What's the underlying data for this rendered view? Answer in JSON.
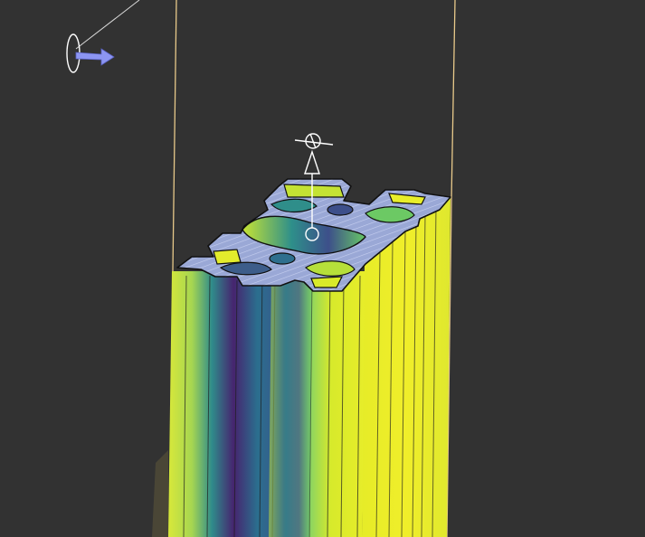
{
  "viewport": {
    "background": "#323232",
    "selection_outline_color": "#e8c98a",
    "gizmo_color": "#ffffff",
    "arrow_color": "#8c95f2"
  },
  "model": {
    "profile_fill": "#9aa8d6",
    "profile_hatch": "#c6cff0",
    "colormap": [
      "#440154",
      "#3b528b",
      "#21918c",
      "#5ec962",
      "#d9ea2a",
      "#fde725"
    ],
    "icons": {
      "light": "light-source-icon",
      "direction": "direction-arrow-icon",
      "rotation": "rotation-gizmo-icon",
      "translation": "translate-gizmo-icon",
      "pivot": "pivot-point-icon"
    }
  }
}
